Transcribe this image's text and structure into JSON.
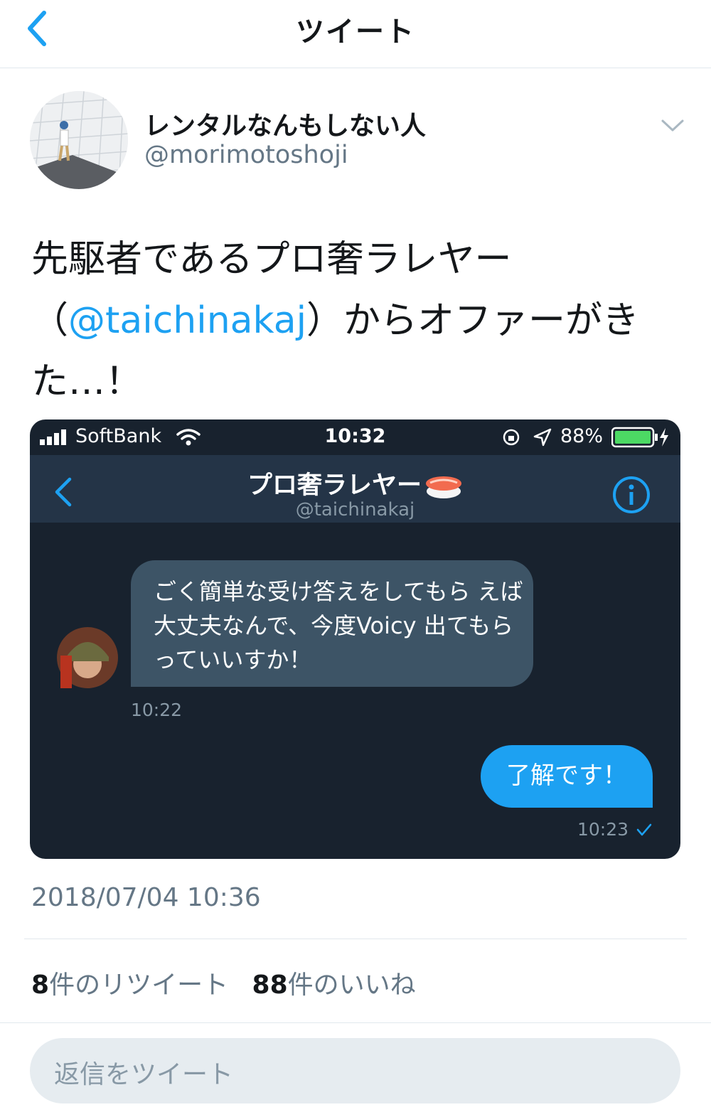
{
  "header": {
    "title": "ツイート"
  },
  "author": {
    "name": "レンタルなんもしない人",
    "handle": "@morimotoshoji"
  },
  "tweet": {
    "text_line1": "先駆者であるプロ奢ラレヤー",
    "text_open": "（",
    "mention": "@taichinakaj",
    "text_after": "）からオファーがき",
    "text_line3": "た…！",
    "timestamp": "2018/07/04 10:36"
  },
  "media": {
    "status": {
      "carrier": "SoftBank",
      "time": "10:32",
      "battery": "88%"
    },
    "nav": {
      "title": "プロ奢ラレヤー",
      "handle": "@taichinakaj"
    },
    "messages": [
      {
        "text": "ごく簡単な受け答えをしてもら えば大丈夫なんで、今度Voicy 出てもらっていいすか！",
        "time": "10:22",
        "incoming": true
      },
      {
        "text": "了解です！",
        "time": "10:23",
        "incoming": false
      }
    ]
  },
  "stats": {
    "retweets_count": "8",
    "retweets_label": "件のリツイート",
    "likes_count": "88",
    "likes_label": "件のいいね"
  },
  "reply": {
    "placeholder": "返信をツイート"
  },
  "colors": {
    "accent": "#1da1f2",
    "dm_bg": "#18222e",
    "bubble_in": "#3d5466"
  }
}
